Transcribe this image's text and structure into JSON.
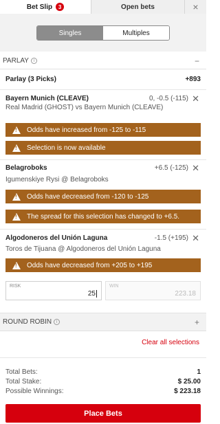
{
  "tabs": {
    "betslip_label": "Bet Slip",
    "betslip_count": "3",
    "open_label": "Open bets",
    "close_glyph": "×"
  },
  "segment": {
    "singles": "Singles",
    "multiples": "Multiples",
    "active": "Singles"
  },
  "parlay": {
    "section_title": "PARLAY",
    "toggle": "−",
    "title": "Parlay (3 Picks)",
    "odds": "+893"
  },
  "selections": [
    {
      "team": "Bayern Munich (CLEAVE)",
      "odds": "0, -0.5 (-115)",
      "match": "Real Madrid (GHOST) vs Bayern Munich (CLEAVE)",
      "alerts": [
        "Odds have increased from -125 to -115",
        "Selection is now available"
      ]
    },
    {
      "team": "Belagroboks",
      "odds": "+6.5 (-125)",
      "match": "Igumenskiye Rysi @ Belagroboks",
      "alerts": [
        "Odds have decreased from -120 to -125",
        "The spread for this selection has changed to +6.5."
      ]
    },
    {
      "team": "Algodoneros del Unión Laguna",
      "odds": "-1.5 (+195)",
      "match": "Toros de Tijuana @ Algodoneros del Unión Laguna",
      "alerts": [
        "Odds have decreased from +205 to +195"
      ]
    }
  ],
  "stake": {
    "risk_label": "RISK",
    "risk_value": "25",
    "win_label": "WIN",
    "win_value": "223.18"
  },
  "round_robin": {
    "section_title": "ROUND ROBIN",
    "toggle": "+"
  },
  "clear_all": "Clear all selections",
  "totals": {
    "bets_label": "Total Bets:",
    "bets_value": "1",
    "stake_label": "Total Stake:",
    "stake_value": "$ 25.00",
    "winnings_label": "Possible Winnings:",
    "winnings_value": "$ 223.18"
  },
  "place_bet": "Place Bets",
  "colors": {
    "brand_red": "#d6000d",
    "alert_brown": "#a3621d",
    "segment_active": "#8c8c8c"
  },
  "icons": [
    "close-icon",
    "info-icon",
    "warning-icon",
    "remove-icon"
  ]
}
